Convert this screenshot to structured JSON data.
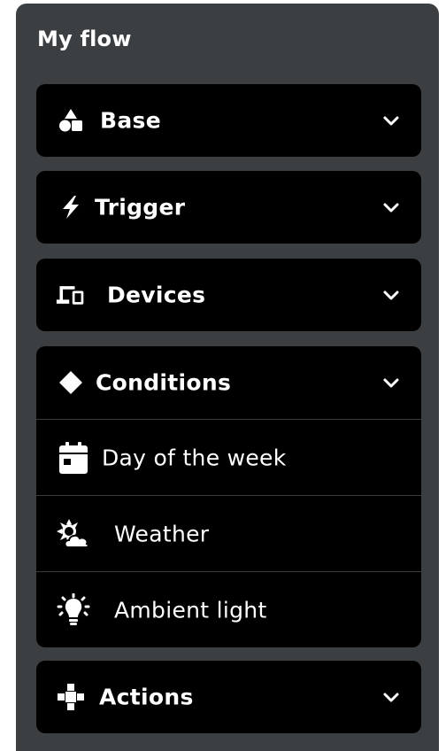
{
  "panel": {
    "title": "My flow",
    "background_color": "#3c3f42",
    "section_color": "#000000",
    "text_color": "#ffffff"
  },
  "sections": {
    "base": {
      "label": "Base",
      "icon": "shapes-icon",
      "expanded": false
    },
    "trigger": {
      "label": "Trigger",
      "icon": "lightning-bolt-icon",
      "expanded": false
    },
    "devices": {
      "label": "Devices",
      "icon": "devices-icon",
      "expanded": false
    },
    "conditions": {
      "label": "Conditions",
      "icon": "diamond-icon",
      "expanded": true,
      "items": [
        {
          "label": "Day of the week",
          "icon": "calendar-icon"
        },
        {
          "label": "Weather",
          "icon": "sun-cloud-icon"
        },
        {
          "label": "Ambient light",
          "icon": "light-bulb-icon"
        }
      ]
    },
    "actions": {
      "label": "Actions",
      "icon": "puzzle-icon",
      "expanded": false
    }
  }
}
